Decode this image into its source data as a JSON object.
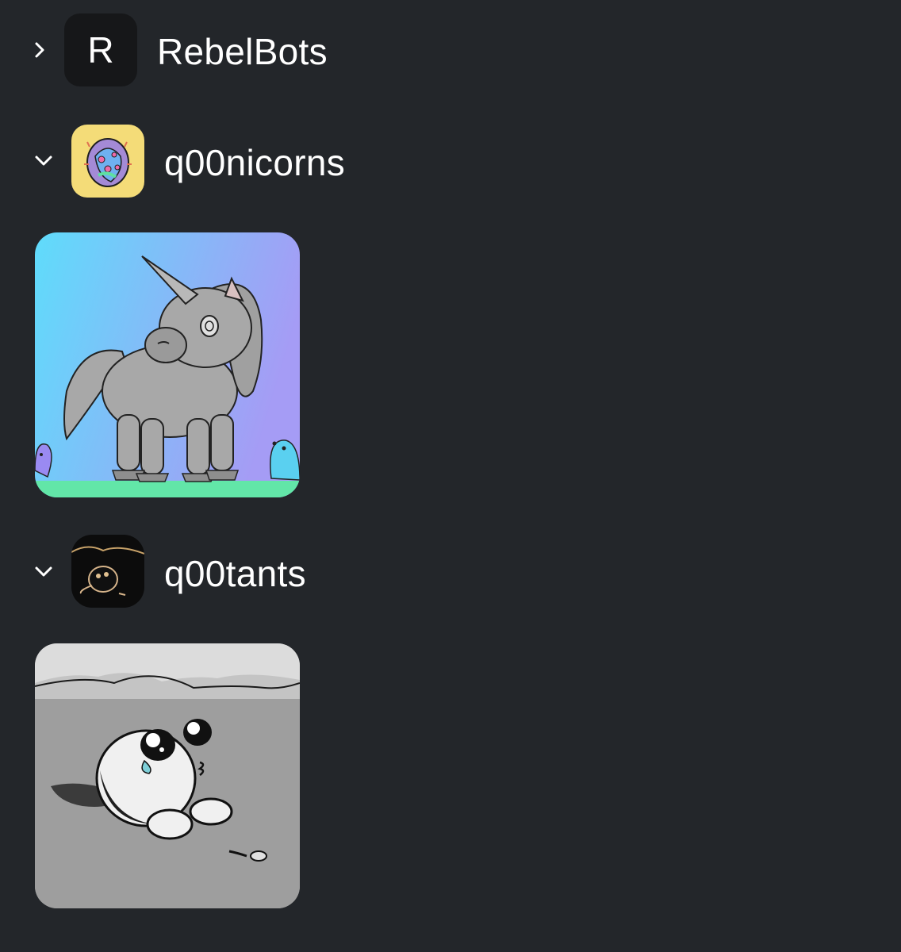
{
  "collections": [
    {
      "name": "RebelBots",
      "avatar_letter": "R",
      "expanded": false,
      "chevron_icon": "chevron-right-icon"
    },
    {
      "name": "q00nicorns",
      "expanded": true,
      "chevron_icon": "chevron-down-icon",
      "avatar_icon": "q00nicorns-logo",
      "items": [
        {
          "image_icon": "unicorn-nft-image"
        }
      ]
    },
    {
      "name": "q00tants",
      "expanded": true,
      "chevron_icon": "chevron-down-icon",
      "avatar_icon": "q00tants-logo",
      "items": [
        {
          "image_icon": "q00tant-nft-image"
        }
      ]
    }
  ],
  "colors": {
    "background": "#23262a",
    "text": "#ffffff",
    "letter_avatar_bg": "#161719"
  }
}
